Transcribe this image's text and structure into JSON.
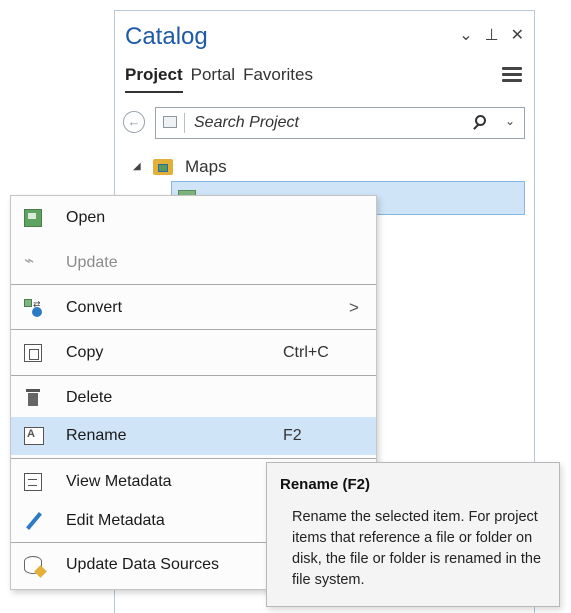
{
  "catalog": {
    "title": "Catalog",
    "controls": {
      "chevron": "⌄",
      "pin": "⊥",
      "close": "✕"
    },
    "tabs": [
      {
        "label": "Project",
        "active": true
      },
      {
        "label": "Portal",
        "active": false
      },
      {
        "label": "Favorites",
        "active": false
      }
    ],
    "search": {
      "placeholder": "Search Project"
    },
    "tree": {
      "maps_label": "Maps"
    }
  },
  "context_menu": {
    "items": [
      {
        "label": "Open",
        "icon": "map-open-icon",
        "enabled": true
      },
      {
        "label": "Update",
        "icon": "update-icon",
        "enabled": false
      },
      {
        "label": "Convert",
        "icon": "convert-icon",
        "submenu": true,
        "arrow": ">"
      },
      {
        "label": "Copy",
        "icon": "copy-icon",
        "shortcut": "Ctrl+C"
      },
      {
        "label": "Delete",
        "icon": "delete-icon"
      },
      {
        "label": "Rename",
        "icon": "rename-icon",
        "shortcut": "F2",
        "highlighted": true
      },
      {
        "label": "View Metadata",
        "icon": "view-metadata-icon"
      },
      {
        "label": "Edit Metadata",
        "icon": "edit-metadata-icon"
      },
      {
        "label": "Update Data Sources",
        "icon": "update-data-sources-icon"
      }
    ]
  },
  "tooltip": {
    "title": "Rename (F2)",
    "body": "Rename the selected item. For project items that reference a file or folder on disk, the file or folder is renamed in the file system."
  },
  "colors": {
    "accent": "#1e5aa8",
    "highlight": "#cfe4f7",
    "selection_border": "#86b7e0"
  }
}
